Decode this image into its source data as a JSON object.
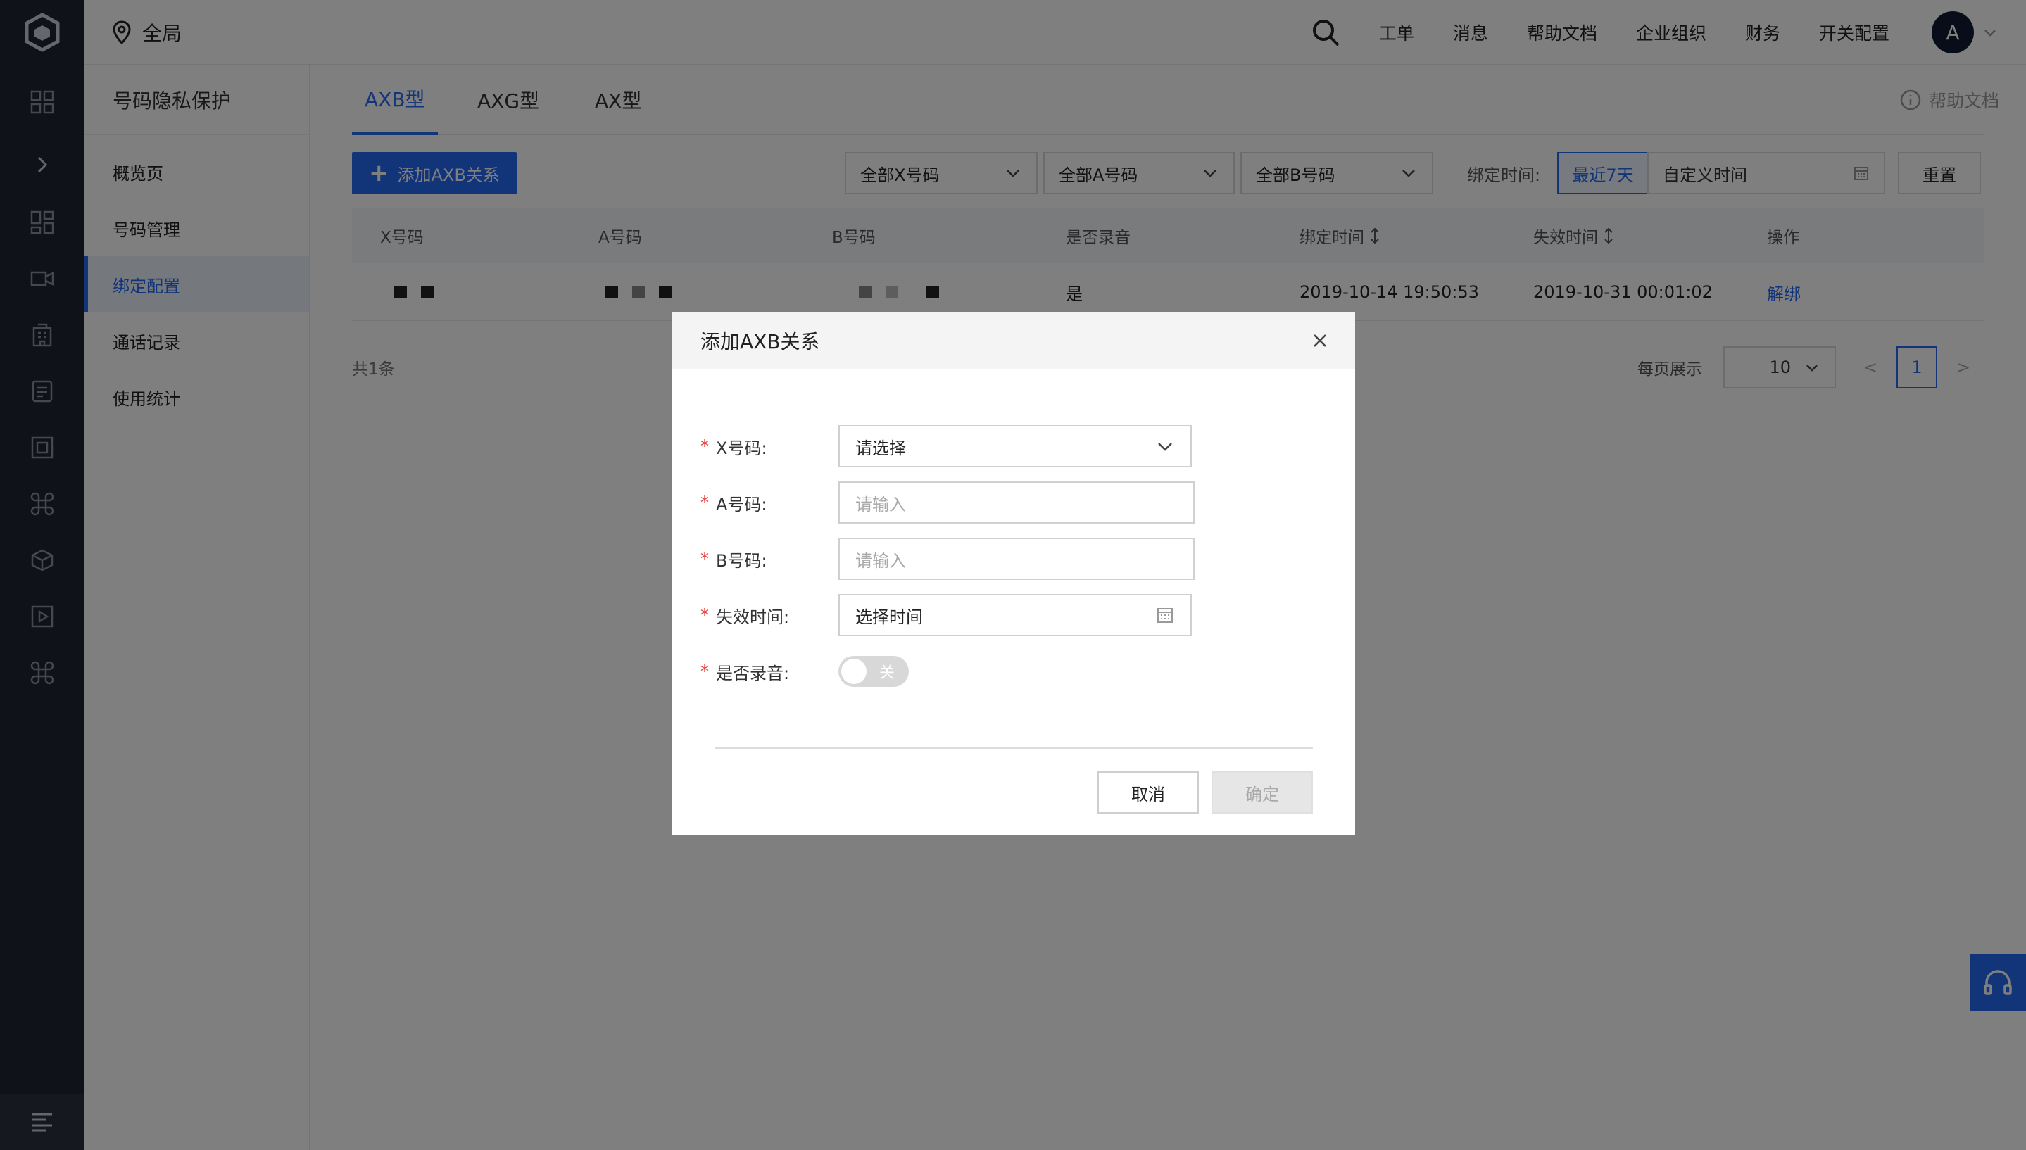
{
  "rail": {
    "icons": [
      "grid-icon",
      "expand-icon",
      "dashboard-icon",
      "video-icon",
      "building-icon",
      "message-icon",
      "screen-icon",
      "command-icon",
      "box-icon",
      "play-icon",
      "command-alt-icon"
    ]
  },
  "header": {
    "region": "全局",
    "nav": [
      "工单",
      "消息",
      "帮助文档",
      "企业组织",
      "财务",
      "开关配置"
    ],
    "avatar": "A"
  },
  "sidebar": {
    "title": "号码隐私保护",
    "items": [
      {
        "label": "概览页",
        "active": false
      },
      {
        "label": "号码管理",
        "active": false
      },
      {
        "label": "绑定配置",
        "active": true
      },
      {
        "label": "通话记录",
        "active": false
      },
      {
        "label": "使用统计",
        "active": false
      }
    ]
  },
  "tabs": [
    "AXB型",
    "AXG型",
    "AX型"
  ],
  "help_doc": "帮助文档",
  "toolbar": {
    "add_button": "添加AXB关系",
    "filter_x": "全部X号码",
    "filter_a": "全部A号码",
    "filter_b": "全部B号码",
    "bind_time_label": "绑定时间:",
    "range_recent": "最近7天",
    "range_custom": "自定义时间",
    "reset": "重置"
  },
  "table": {
    "columns": [
      "X号码",
      "A号码",
      "B号码",
      "是否录音",
      "绑定时间",
      "失效时间",
      "操作"
    ],
    "rows": [
      {
        "record": "是",
        "bind_time": "2019-10-14 19:50:53",
        "expire_time": "2019-10-31 00:01:02",
        "action": "解绑"
      }
    ]
  },
  "pagination": {
    "total": "共1条",
    "page_size_label": "每页展示",
    "page_size": "10",
    "prev": "<",
    "page": "1",
    "next": ">"
  },
  "modal": {
    "title": "添加AXB关系",
    "fields": {
      "x_label": "X号码:",
      "x_value": "请选择",
      "a_label": "A号码:",
      "a_placeholder": "请输入",
      "b_label": "B号码:",
      "b_placeholder": "请输入",
      "expire_label": "失效时间:",
      "expire_value": "选择时间",
      "record_label": "是否录音:",
      "record_switch": "关"
    },
    "required_mark": "*",
    "cancel": "取消",
    "confirm": "确定"
  },
  "colors": {
    "accent": "#2468f2",
    "rail_bg": "#1f2733",
    "required": "#e63c3c"
  }
}
